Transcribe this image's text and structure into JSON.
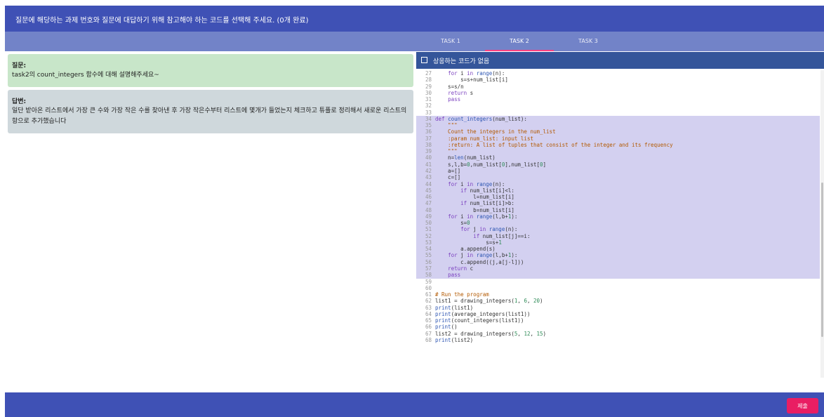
{
  "header": {
    "instruction": "질문에 해당하는 과제 번호와 질문에 대답하기 위해 참고해야 하는 코드를 선택해 주세요. (0개 완료)"
  },
  "question": {
    "label": "질문:",
    "text": "task2의 count_integers 함수에 대해 설명해주세요~"
  },
  "answer": {
    "label": "답변:",
    "text": "일단 받아온 리스트에서 가장 큰 수와 가장 작은 수를 찾아낸 후 가장 작은수부터 리스트에 몇개가 들었는지 체크하고 튜플로 정리해서 새로운 리스트의 항으로 추가했습니다"
  },
  "tabs": [
    {
      "label": "TASK 1",
      "active": false
    },
    {
      "label": "TASK 2",
      "active": true
    },
    {
      "label": "TASK 3",
      "active": false
    }
  ],
  "no_code_option": {
    "label": "상응하는 코드가 없음",
    "checked": false
  },
  "code_lines": [
    {
      "n": "27",
      "code": "    for i in range(n):",
      "hl": false
    },
    {
      "n": "28",
      "code": "        s=s+num_list[i]",
      "hl": false
    },
    {
      "n": "29",
      "code": "    s=s/n",
      "hl": false
    },
    {
      "n": "30",
      "code": "    return s",
      "hl": false
    },
    {
      "n": "31",
      "code": "    pass",
      "hl": false
    },
    {
      "n": "32",
      "code": "",
      "hl": false
    },
    {
      "n": "33",
      "code": "",
      "hl": false
    },
    {
      "n": "34",
      "code": "def count_integers(num_list):",
      "hl": true
    },
    {
      "n": "35",
      "code": "    \"\"\"",
      "hl": true
    },
    {
      "n": "36",
      "code": "    Count the integers in the num_list",
      "hl": true
    },
    {
      "n": "37",
      "code": "    :param num_list: input list",
      "hl": true
    },
    {
      "n": "38",
      "code": "    :return: A list of tuples that consist of the integer and its frequency",
      "hl": true
    },
    {
      "n": "39",
      "code": "    \"\"\"",
      "hl": true
    },
    {
      "n": "40",
      "code": "    n=len(num_list)",
      "hl": true
    },
    {
      "n": "41",
      "code": "    s,l,b=0,num_list[0],num_list[0]",
      "hl": true
    },
    {
      "n": "42",
      "code": "    a=[]",
      "hl": true
    },
    {
      "n": "43",
      "code": "    c=[]",
      "hl": true
    },
    {
      "n": "44",
      "code": "    for i in range(n):",
      "hl": true
    },
    {
      "n": "45",
      "code": "        if num_list[i]<l:",
      "hl": true
    },
    {
      "n": "46",
      "code": "            l=num_list[i]",
      "hl": true
    },
    {
      "n": "47",
      "code": "        if num_list[i]>b:",
      "hl": true
    },
    {
      "n": "48",
      "code": "            b=num_list[i]",
      "hl": true
    },
    {
      "n": "49",
      "code": "    for i in range(l,b+1):",
      "hl": true
    },
    {
      "n": "50",
      "code": "        s=0",
      "hl": true
    },
    {
      "n": "51",
      "code": "        for j in range(n):",
      "hl": true
    },
    {
      "n": "52",
      "code": "            if num_list[j]==i:",
      "hl": true
    },
    {
      "n": "53",
      "code": "                s=s+1",
      "hl": true
    },
    {
      "n": "54",
      "code": "        a.append(s)",
      "hl": true
    },
    {
      "n": "55",
      "code": "    for j in range(l,b+1):",
      "hl": true
    },
    {
      "n": "56",
      "code": "        c.append((j,a[j-l]))",
      "hl": true
    },
    {
      "n": "57",
      "code": "    return c",
      "hl": true
    },
    {
      "n": "58",
      "code": "    pass",
      "hl": true
    },
    {
      "n": "59",
      "code": "",
      "hl": false
    },
    {
      "n": "60",
      "code": "",
      "hl": false
    },
    {
      "n": "61",
      "code": "# Run the program",
      "hl": false
    },
    {
      "n": "62",
      "code": "list1 = drawing_integers(1, 6, 20)",
      "hl": false
    },
    {
      "n": "63",
      "code": "print(list1)",
      "hl": false
    },
    {
      "n": "64",
      "code": "print(average_integers(list1))",
      "hl": false
    },
    {
      "n": "65",
      "code": "print(count_integers(list1))",
      "hl": false
    },
    {
      "n": "66",
      "code": "print()",
      "hl": false
    },
    {
      "n": "67",
      "code": "list2 = drawing_integers(5, 12, 15)",
      "hl": false
    },
    {
      "n": "68",
      "code": "print(list2)",
      "hl": false
    }
  ],
  "footer": {
    "submit_label": "제출"
  },
  "colors": {
    "primary": "#3f51b5",
    "tabbar": "#7283c8",
    "accent": "#e91e63",
    "question_bg": "#c8e6c9",
    "answer_bg": "#cfd8dc",
    "highlight": "#d3d0f0"
  }
}
